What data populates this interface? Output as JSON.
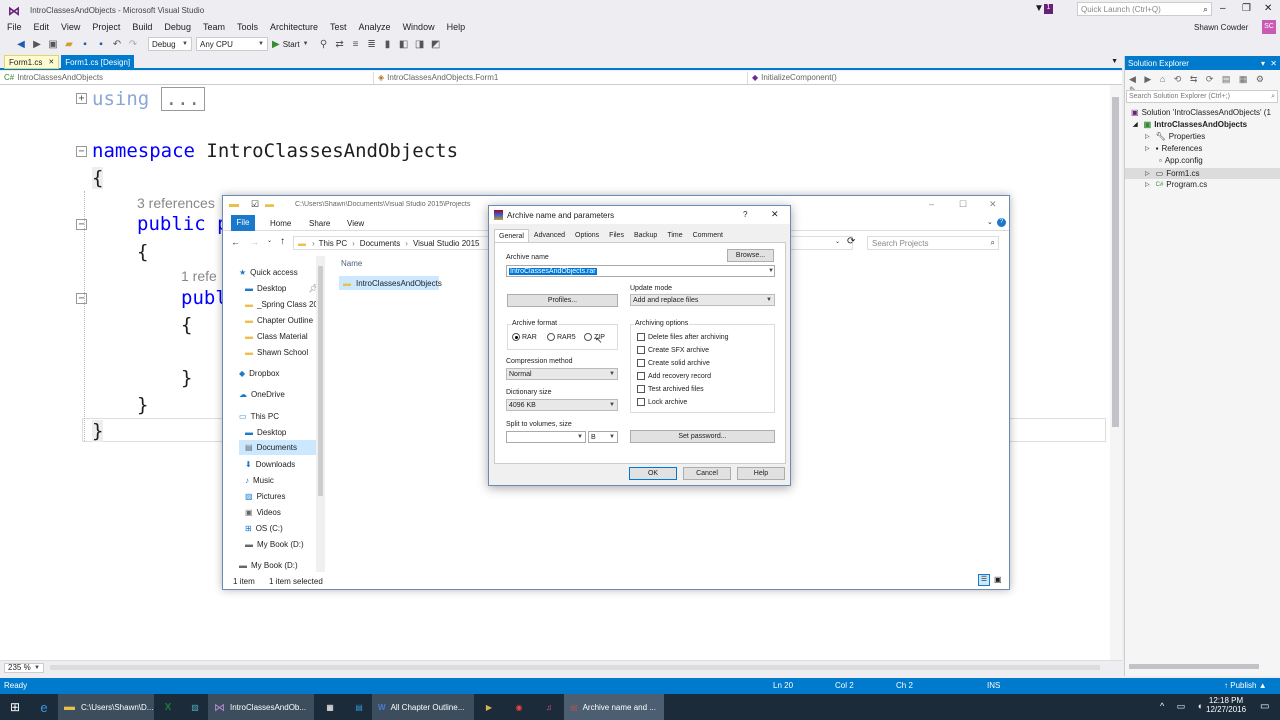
{
  "vs": {
    "title": "IntroClassesAndObjects - Microsoft Visual Studio",
    "notification_count": "1",
    "quick_launch_placeholder": "Quick Launch (Ctrl+Q)",
    "user": "Shawn Cowder",
    "user_initials": "SC",
    "menu": [
      "File",
      "Edit",
      "View",
      "Project",
      "Build",
      "Debug",
      "Team",
      "Tools",
      "Architecture",
      "Test",
      "Analyze",
      "Window",
      "Help"
    ],
    "toolbar": {
      "config": "Debug",
      "platform": "Any CPU",
      "start_label": "Start"
    },
    "tabs": [
      "Form1.cs",
      "Form1.cs [Design]"
    ],
    "nav": {
      "project": "IntroClassesAndObjects",
      "class": "IntroClassesAndObjects.Form1",
      "member": "InitializeComponent()"
    },
    "code": {
      "using_kw": "using",
      "collapsed": "...",
      "namespace_kw": "namespace",
      "namespace_name": "IntroClassesAndObjects",
      "brace_open": "{",
      "brace_close": "}",
      "refs3": "3 references",
      "public_p": "public p",
      "refs1": "1 refe",
      "publ": "publ"
    },
    "zoom": "235 %",
    "status": {
      "ready": "Ready",
      "ln": "Ln 20",
      "col": "Col 2",
      "ch": "Ch 2",
      "ins": "INS",
      "publish": "Publish"
    }
  },
  "solution_explorer": {
    "title": "Solution Explorer",
    "search_placeholder": "Search Solution Explorer (Ctrl+;)",
    "items": [
      "Solution 'IntroClassesAndObjects' (1",
      "IntroClassesAndObjects",
      "Properties",
      "References",
      "App.config",
      "Form1.cs",
      "Program.cs"
    ]
  },
  "explorer": {
    "path_title": "C:\\Users\\Shawn\\Documents\\Visual Studio 2015\\Projects",
    "ribbon_tabs": [
      "File",
      "Home",
      "Share",
      "View"
    ],
    "breadcrumb": [
      "This PC",
      "Documents",
      "Visual Studio 2015"
    ],
    "search_placeholder": "Search Projects",
    "nav_items": [
      "Quick access",
      "Desktop",
      "_Spring Class 20",
      "Chapter Outline",
      "Class Material",
      "Shawn School",
      "Dropbox",
      "OneDrive",
      "This PC",
      "Desktop",
      "Documents",
      "Downloads",
      "Music",
      "Pictures",
      "Videos",
      "OS (C:)",
      "My Book (D:)",
      "My Book (D:)"
    ],
    "column_name": "Name",
    "file": "IntroClassesAndObjects",
    "status_count": "1 item",
    "status_selected": "1 item selected"
  },
  "rar": {
    "title": "Archive name and parameters",
    "help": "?",
    "tabs": [
      "General",
      "Advanced",
      "Options",
      "Files",
      "Backup",
      "Time",
      "Comment"
    ],
    "archive_name_label": "Archive name",
    "browse": "Browse...",
    "archive_name": "IntroClassesAndObjects.rar",
    "profiles": "Profiles...",
    "update_mode_label": "Update mode",
    "update_mode": "Add and replace files",
    "archive_format_label": "Archive format",
    "formats": [
      "RAR",
      "RAR5",
      "ZIP"
    ],
    "archiving_options_label": "Archiving options",
    "options": [
      "Delete files after archiving",
      "Create SFX archive",
      "Create solid archive",
      "Add recovery record",
      "Test archived files",
      "Lock archive"
    ],
    "compression_label": "Compression method",
    "compression": "Normal",
    "dictionary_label": "Dictionary size",
    "dictionary": "4096 KB",
    "split_label": "Split to volumes, size",
    "split_unit": "B",
    "set_password": "Set password...",
    "ok": "OK",
    "cancel": "Cancel",
    "help_btn": "Help"
  },
  "taskbar": {
    "items": [
      "C:\\Users\\Shawn\\D...",
      "IntroClassesAndOb...",
      "All Chapter Outline...",
      "Archive name and ..."
    ],
    "time": "12:18 PM",
    "date": "12/27/2016"
  }
}
